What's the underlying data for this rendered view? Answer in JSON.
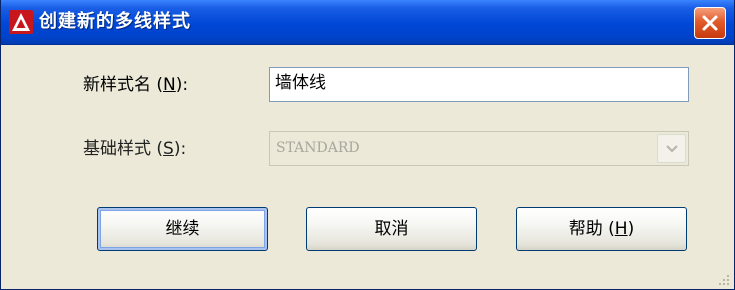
{
  "window": {
    "title": "创建新的多线样式"
  },
  "form": {
    "name_label_prefix": "新样式名 (",
    "name_label_mnemonic": "N",
    "name_label_suffix": "):",
    "name_value": "墙体线",
    "base_label_prefix": "基础样式 (",
    "base_label_mnemonic": "S",
    "base_label_suffix": "):",
    "base_value": "STANDARD"
  },
  "buttons": {
    "continue": "继续",
    "cancel": "取消",
    "help_prefix": "帮助 (",
    "help_mnemonic": "H",
    "help_suffix": ")"
  },
  "icons": {
    "app": "autocad-logo-icon",
    "close": "close-icon",
    "dropdown": "chevron-down-icon",
    "resize": "resize-grip-icon"
  },
  "colors": {
    "titlebar": "#0047d6",
    "close_button": "#e25b2a",
    "dialog_background": "#ece9d8"
  }
}
